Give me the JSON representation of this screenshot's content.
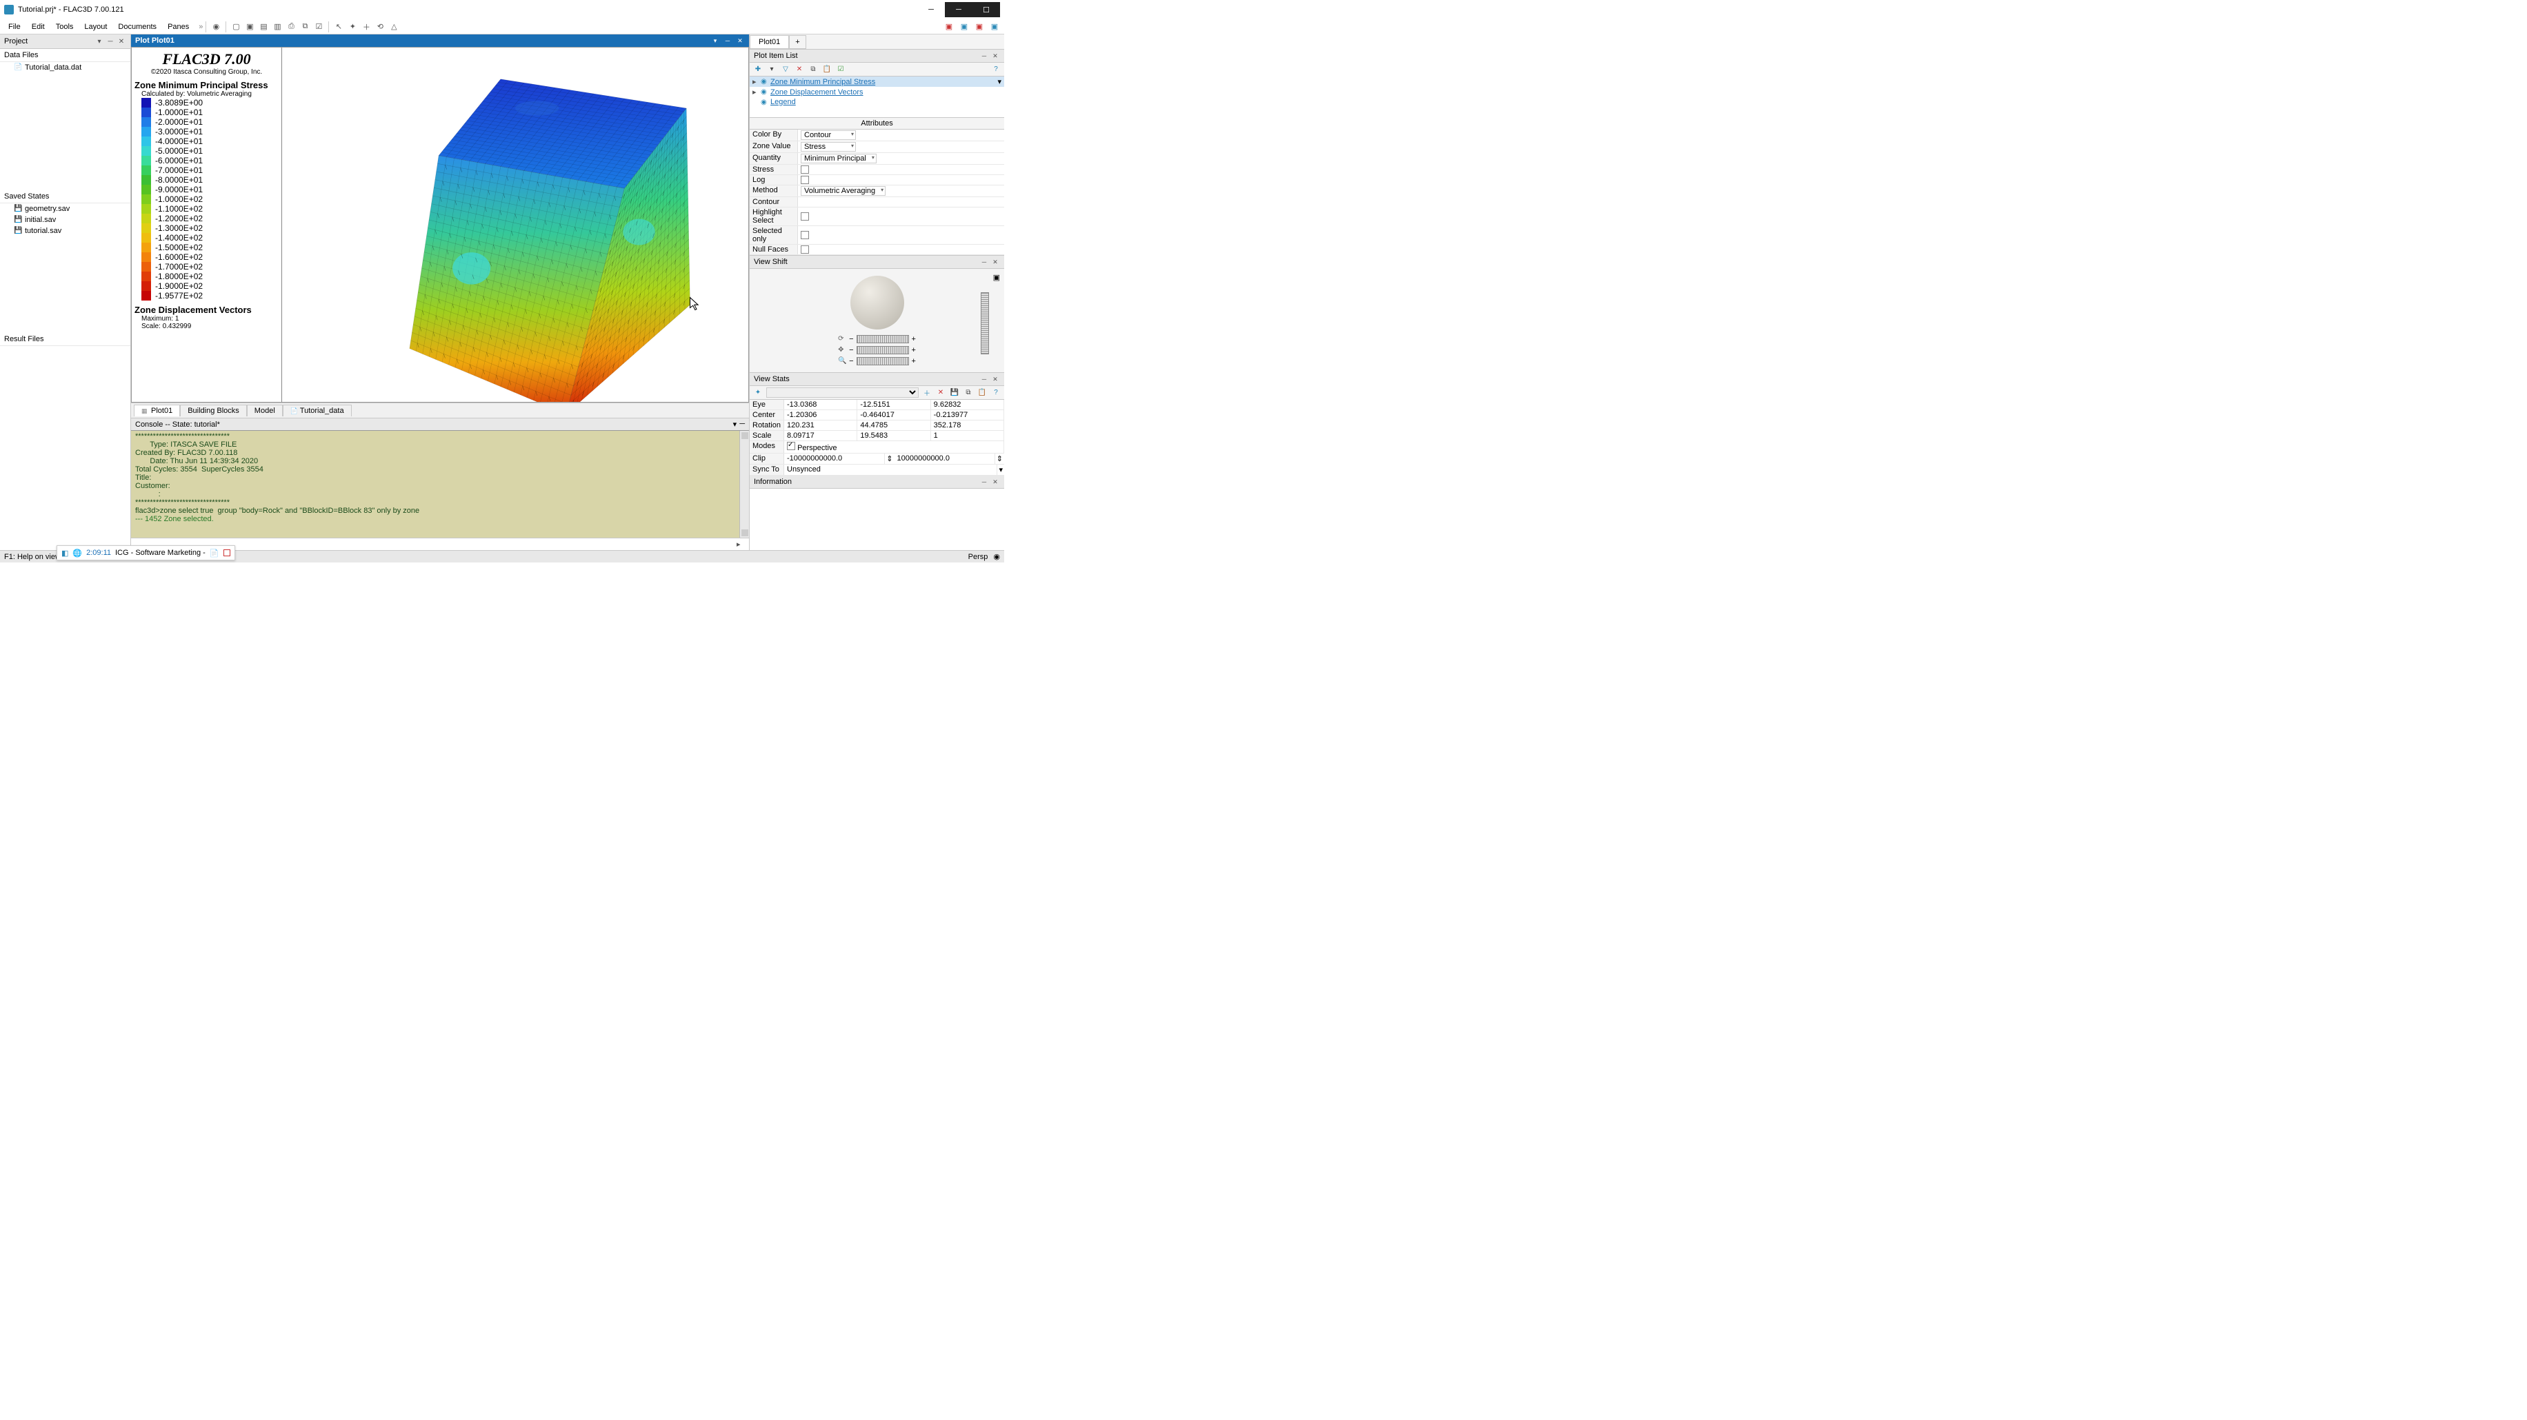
{
  "window": {
    "title": "Tutorial.prj* - FLAC3D 7.00.121"
  },
  "menu": [
    "File",
    "Edit",
    "Tools",
    "Layout",
    "Documents",
    "Panes"
  ],
  "sidebar": {
    "title": "Project",
    "sections": {
      "datafiles": {
        "label": "Data Files",
        "items": [
          "Tutorial_data.dat"
        ]
      },
      "savedstates": {
        "label": "Saved States",
        "items": [
          "geometry.sav",
          "initial.sav",
          "tutorial.sav"
        ]
      },
      "resultfiles": {
        "label": "Result Files"
      }
    }
  },
  "plot": {
    "header": "Plot Plot01",
    "product_title": "FLAC3D 7.00",
    "product_sub": "©2020 Itasca Consulting Group, Inc.",
    "legend1": {
      "title": "Zone Minimum Principal Stress",
      "sub": "Calculated by: Volumetric Averaging",
      "scale": [
        {
          "c": "#1313b5",
          "v": "-3.8089E+00"
        },
        {
          "c": "#1a4bd6",
          "v": "-1.0000E+01"
        },
        {
          "c": "#1f7de8",
          "v": "-2.0000E+01"
        },
        {
          "c": "#25a5ef",
          "v": "-3.0000E+01"
        },
        {
          "c": "#2fc5e8",
          "v": "-4.0000E+01"
        },
        {
          "c": "#38d9cf",
          "v": "-5.0000E+01"
        },
        {
          "c": "#3adc9a",
          "v": "-6.0000E+01"
        },
        {
          "c": "#37cf5e",
          "v": "-7.0000E+01"
        },
        {
          "c": "#3cbf33",
          "v": "-8.0000E+01"
        },
        {
          "c": "#57c321",
          "v": "-9.0000E+01"
        },
        {
          "c": "#7fce1c",
          "v": "-1.0000E+02"
        },
        {
          "c": "#a7d518",
          "v": "-1.1000E+02"
        },
        {
          "c": "#c8d514",
          "v": "-1.2000E+02"
        },
        {
          "c": "#e1cf12",
          "v": "-1.3000E+02"
        },
        {
          "c": "#efbe10",
          "v": "-1.4000E+02"
        },
        {
          "c": "#f4a20e",
          "v": "-1.5000E+02"
        },
        {
          "c": "#f3830c",
          "v": "-1.6000E+02"
        },
        {
          "c": "#ec600a",
          "v": "-1.7000E+02"
        },
        {
          "c": "#e13d08",
          "v": "-1.8000E+02"
        },
        {
          "c": "#d41f06",
          "v": "-1.9000E+02"
        },
        {
          "c": "#c60404",
          "v": "-1.9577E+02"
        }
      ]
    },
    "legend2": {
      "title": "Zone Displacement Vectors",
      "max": "Maximum: 1",
      "scale": "Scale: 0.432999"
    },
    "tabs": [
      "Plot01",
      "Building Blocks",
      "Model",
      "Tutorial_data"
    ]
  },
  "console": {
    "header": "Console -- State: tutorial*",
    "lines": [
      "********************************",
      "       Type: ITASCA SAVE FILE",
      "Created By: FLAC3D 7.00.118",
      "       Date: Thu Jun 11 14:39:34 2020",
      "Total Cycles: 3554  SuperCycles 3554",
      "Title:",
      "Customer:",
      "           :",
      "********************************",
      "flac3d>zone select true  group \"body=Rock\" and \"BBlockID=BBlock 83\" only by zone",
      "--- 1452 Zone selected."
    ]
  },
  "right": {
    "tabs": {
      "main": "Plot01"
    },
    "plotitems": {
      "header": "Plot Item List",
      "items": [
        {
          "label": "Zone Minimum Principal Stress",
          "selected": true,
          "exp": "▸"
        },
        {
          "label": "Zone Displacement Vectors",
          "selected": false,
          "exp": "▸"
        },
        {
          "label": "Legend",
          "selected": false,
          "exp": ""
        }
      ]
    },
    "attributes": {
      "header": "Attributes",
      "rows": [
        {
          "label": "Color By",
          "val": "Contour",
          "combo": true
        },
        {
          "label": "Zone Value",
          "val": "Stress",
          "combo": true
        },
        {
          "label": "Quantity",
          "val": "Minimum Principal",
          "combo": true
        },
        {
          "label": "Stress",
          "chk": true
        },
        {
          "label": "Log",
          "chk": true
        },
        {
          "label": "Method",
          "val": "Volumetric Averaging",
          "combo": true
        },
        {
          "label": "Contour",
          "val": ""
        },
        {
          "label": "Highlight Select",
          "chk": true
        },
        {
          "label": "Selected only",
          "chk": true
        },
        {
          "label": "Null Faces",
          "chk": true
        }
      ]
    },
    "viewshift": {
      "header": "View Shift"
    },
    "viewstats": {
      "header": "View Stats",
      "rows": [
        {
          "label": "Eye",
          "v": [
            "-13.0368",
            "-12.5151",
            "9.62832"
          ]
        },
        {
          "label": "Center",
          "v": [
            "-1.20306",
            "-0.464017",
            "-0.213977"
          ]
        },
        {
          "label": "Rotation",
          "v": [
            "120.231",
            "44.4785",
            "352.178"
          ]
        },
        {
          "label": "Scale",
          "v": [
            "8.09717",
            "19.5483",
            "1"
          ]
        }
      ],
      "modes_label": "Modes",
      "modes_val": "Perspective",
      "clip_label": "Clip",
      "clip_lo": "-10000000000.0",
      "clip_hi": "10000000000.0",
      "syncto_label": "Sync To",
      "syncto_val": "Unsynced",
      "info": "Information"
    }
  },
  "status": {
    "left": "F1: Help on view",
    "time": "2:09:11",
    "task": "ICG - Software Marketing -",
    "persp": "Persp"
  },
  "chart_data": {
    "type": "heatmap",
    "title": "Zone Minimum Principal Stress",
    "calc_method": "Volumetric Averaging",
    "colorscale_label": "Stress",
    "values": [
      -3.8089,
      -10,
      -20,
      -30,
      -40,
      -50,
      -60,
      -70,
      -80,
      -90,
      -100,
      -110,
      -120,
      -130,
      -140,
      -150,
      -160,
      -170,
      -180,
      -190,
      -195.77
    ],
    "colors": [
      "#1313b5",
      "#1a4bd6",
      "#1f7de8",
      "#25a5ef",
      "#2fc5e8",
      "#38d9cf",
      "#3adc9a",
      "#37cf5e",
      "#3cbf33",
      "#57c321",
      "#7fce1c",
      "#a7d518",
      "#c8d514",
      "#e1cf12",
      "#efbe10",
      "#f4a20e",
      "#f3830c",
      "#ec600a",
      "#e13d08",
      "#d41f06",
      "#c60404"
    ],
    "vectors": {
      "maximum": 1,
      "scale": 0.432999
    }
  }
}
